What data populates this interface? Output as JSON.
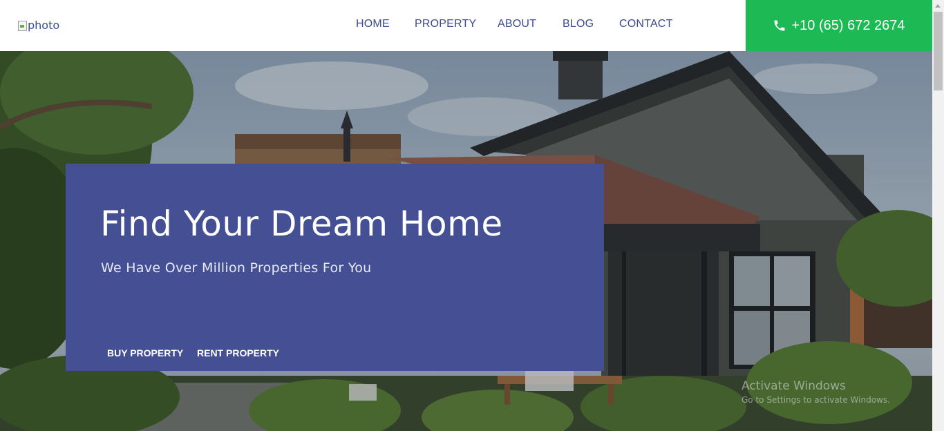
{
  "header": {
    "logo_alt": "photo",
    "nav": [
      {
        "label": "HOME"
      },
      {
        "label": "PROPERTY"
      },
      {
        "label": "ABOUT"
      },
      {
        "label": "BLOG"
      },
      {
        "label": "CONTACT"
      }
    ],
    "phone": "+10 (65) 672 2674",
    "phone_bg": "#1db954"
  },
  "hero": {
    "title": "Find Your Dream Home",
    "subtitle": "We Have Over Million Properties For You",
    "card_bg": "#454f93",
    "tabs": [
      {
        "label": "BUY PROPERTY"
      },
      {
        "label": "RENT PROPERTY"
      }
    ]
  },
  "watermark": {
    "title": "Activate Windows",
    "subtitle": "Go to Settings to activate Windows."
  },
  "icons": {
    "phone": "phone-icon",
    "logo": "broken-image-icon"
  }
}
